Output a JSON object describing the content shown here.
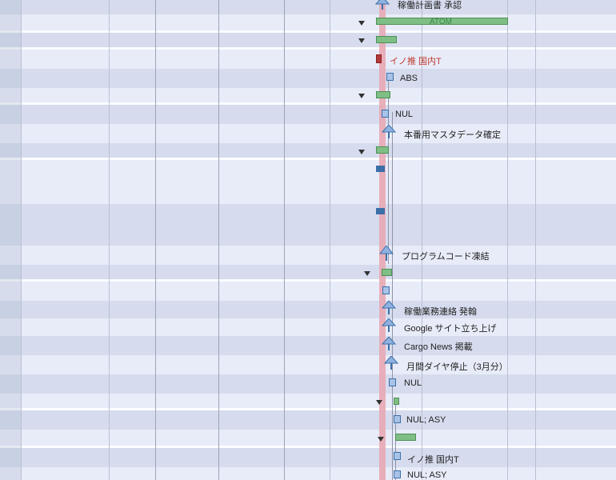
{
  "colors": {
    "today_line": "#e8a9b4",
    "task_blue": "#3c6fa8",
    "summary_green": "#7fbf85",
    "red_task": "#b23a3a"
  },
  "icons": {
    "milestone": "milestone-arrow-icon",
    "collapse": "disclosure-triangle-icon",
    "task": "task-box-icon"
  },
  "rows": {
    "kadou_shonin": "稼働計画書 承認",
    "atom": "ATOM",
    "inosui_1": "イノ推 国内T",
    "abs": "ABS",
    "nul_1": "NUL",
    "honban_master": "本番用マスタデータ確定",
    "program_freeze": "プログラムコード凍結",
    "kadou_gyomu": "稼働業務連絡 発翰",
    "google_site": "Google サイト立ち上げ",
    "cargo_news": "Cargo News 掲載",
    "getsukan_dia": "月間ダイヤ停止（3月分）",
    "nul_2": "NUL",
    "nul_asy_1": "NUL; ASY",
    "inosui_2": "イノ推 国内T",
    "nul_asy_2": "NUL; ASY"
  }
}
